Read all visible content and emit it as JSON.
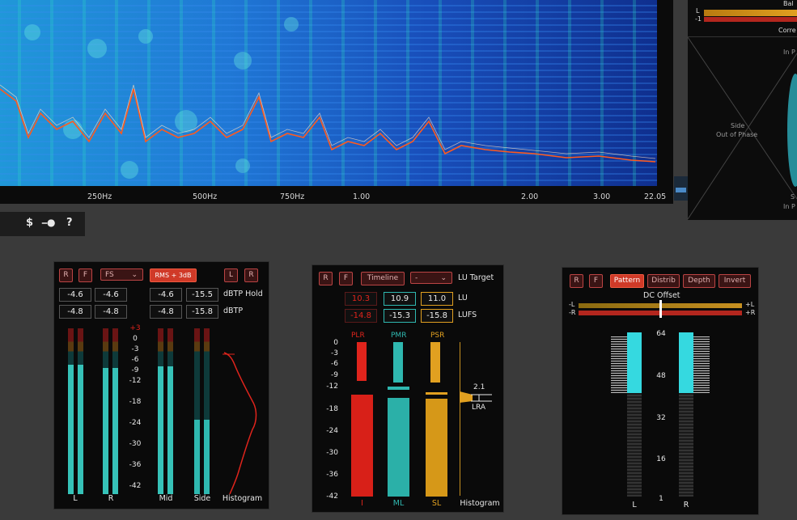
{
  "spectrum": {
    "freq_labels": [
      "250Hz",
      "500Hz",
      "750Hz",
      "1.00",
      "2.00",
      "3.00",
      "22.05"
    ]
  },
  "vu_right": {
    "lbl_l": "L",
    "lbl_minus1": "-1",
    "lbl_bal": "Bal",
    "lbl_corr": "Corre",
    "lbl_inph_top": "In P",
    "lbl_side": "Side",
    "lbl_oop": "Out of Phase",
    "lbl_s": "S",
    "lbl_inph_bot": "In P"
  },
  "toolbar": {
    "dollar_icon": "$",
    "key_icon": "key",
    "help": "?"
  },
  "level_meter": {
    "btn_r": "R",
    "btn_f": "F",
    "fs_select": "FS",
    "rms_btn": "RMS + 3dB",
    "btn_l2": "L",
    "btn_r2": "R",
    "hold_values": [
      "-4.6",
      "-4.6",
      "-4.6",
      "-15.5"
    ],
    "hold_label": "dBTP Hold",
    "values": [
      "-4.8",
      "-4.8",
      "-4.8",
      "-15.8"
    ],
    "value_label": "dBTP",
    "scale": [
      "+3",
      "0",
      "-3",
      "-6",
      "-9",
      "-12",
      "-18",
      "-24",
      "-30",
      "-36",
      "-42"
    ],
    "channel_labels": [
      "L",
      "R",
      "Mid",
      "Side",
      "Histogram"
    ],
    "channel_levels": [
      0.78,
      0.76,
      0.77,
      0.45
    ]
  },
  "loudness_meter": {
    "btn_r": "R",
    "btn_f": "F",
    "timeline_btn": "Timeline",
    "target_select": "-",
    "target_label": "LU Target",
    "lu_values": [
      "10.3",
      "10.9",
      "11.0"
    ],
    "lu_label": "LU",
    "lufs_values": [
      "-14.8",
      "-15.3",
      "-15.8"
    ],
    "lufs_label": "LUFS",
    "col_heads": [
      "PLR",
      "PMR",
      "PSR"
    ],
    "scale": [
      "0",
      "-3",
      "-6",
      "-9",
      "-12",
      "-18",
      "-24",
      "-30",
      "-36",
      "-42"
    ],
    "foot_labels": [
      "I",
      "ML",
      "SL",
      "Histogram"
    ],
    "lra_value": "2.1",
    "lra_label": "LRA",
    "colors": {
      "plr": "#e0241c",
      "pmr": "#2fb8b0",
      "psr": "#e1a020"
    }
  },
  "dc_meter": {
    "btn_r": "R",
    "btn_f": "F",
    "pattern_btn": "Pattern",
    "distrib_btn": "Distrib",
    "depth_btn": "Depth",
    "invert_btn": "Invert",
    "title": "DC Offset",
    "row1_left": "-L",
    "row1_right": "+L",
    "row2_left": "-R",
    "row2_right": "+R",
    "scale": [
      "64",
      "48",
      "32",
      "16",
      "1"
    ],
    "channel_labels": [
      "L",
      "R"
    ]
  }
}
